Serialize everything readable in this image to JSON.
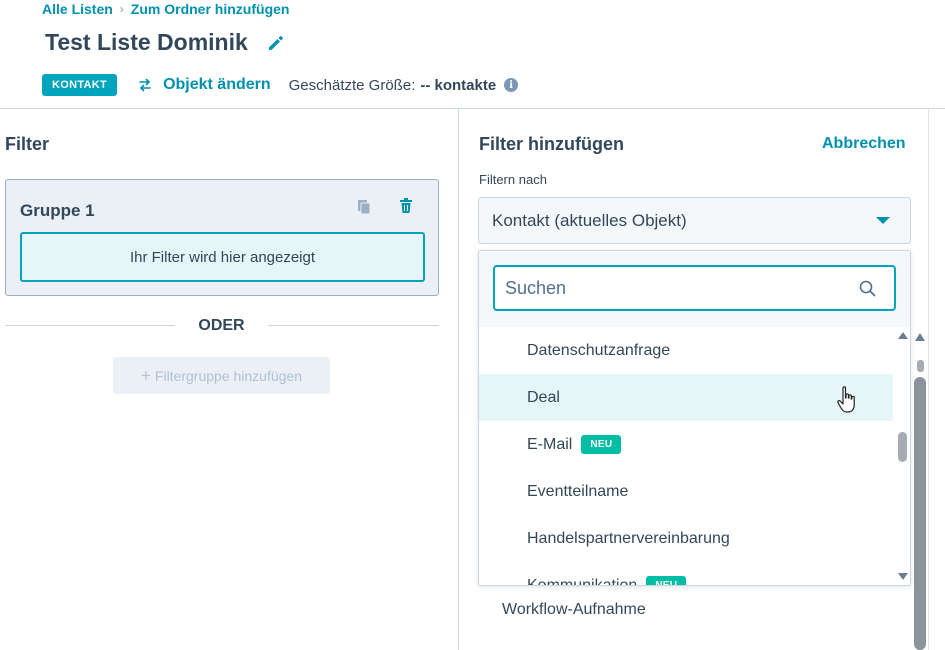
{
  "breadcrumb": {
    "root": "Alle Listen",
    "separator": "›",
    "current": "Zum Ordner hinzufügen"
  },
  "header": {
    "title": "Test Liste Dominik"
  },
  "meta": {
    "object_badge": "KONTAKT",
    "change_object": "Objekt ändern",
    "size_label": "Geschätzte Größe:",
    "size_value": "-- kontakte",
    "info_glyph": "i"
  },
  "filter_panel": {
    "heading": "Filter",
    "group_title": "Gruppe 1",
    "placeholder": "Ihr Filter wird hier angezeigt",
    "or_label": "ODER",
    "add_group_label": "Filtergruppe hinzufügen",
    "add_group_glyph": "+"
  },
  "add_filter": {
    "heading": "Filter hinzufügen",
    "cancel": "Abbrechen",
    "filter_by_label": "Filtern nach",
    "selected_object": "Kontakt (aktuelles Objekt)",
    "search_placeholder": "Suchen",
    "options": [
      {
        "label": "Datenschutzanfrage",
        "badge": ""
      },
      {
        "label": "Deal",
        "badge": ""
      },
      {
        "label": "E-Mail",
        "badge": "NEU"
      },
      {
        "label": "Eventteilname",
        "badge": ""
      },
      {
        "label": "Handelspartnervereinbarung",
        "badge": ""
      },
      {
        "label": "Kommunikation",
        "badge": "NEU"
      }
    ],
    "background_option": "Workflow-Aufnahme"
  },
  "colors": {
    "accent": "#00a4bd",
    "link": "#0091ae",
    "text": "#33475b",
    "new_badge": "#00bda5",
    "group_bg": "#eaf0f6"
  }
}
